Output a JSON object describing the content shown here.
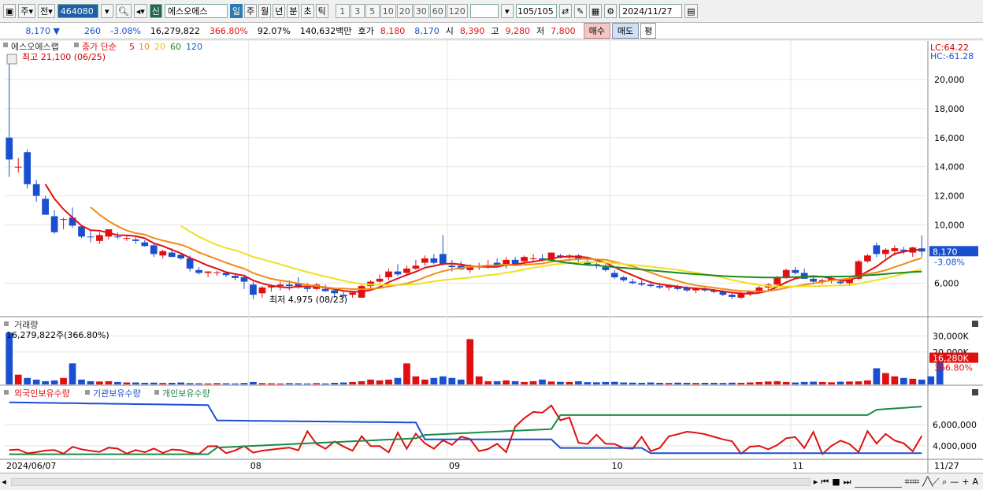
{
  "toolbar": {
    "market_label": "주",
    "type_label": "전",
    "code": "464080",
    "new_label": "신",
    "stock_name": "에스오에스",
    "periods": [
      "일",
      "주",
      "월",
      "년",
      "분",
      "초",
      "틱"
    ],
    "active_period": "일",
    "intervals": [
      "1",
      "3",
      "5",
      "10",
      "20",
      "30",
      "60",
      "120"
    ],
    "count": "105/105",
    "date": "2024/11/27"
  },
  "quote": {
    "price": "8,170",
    "change": "260",
    "change_pct": "-3.08%",
    "volume": "16,279,822",
    "volume_ratio": "366.80%",
    "turnover": "92.07%",
    "amount": "140,632백만",
    "ask_label": "호가",
    "ask": "8,180",
    "bid": "8,170",
    "open_label": "시",
    "open": "8,390",
    "high_label": "고",
    "high": "9,280",
    "low_label": "저",
    "low": "7,800",
    "buy_label": "매수",
    "sell_label": "매도",
    "eval_label": "평"
  },
  "chart_data": {
    "type": "candlestick",
    "price_panel": {
      "title": "에스오에스랩",
      "ma_label": "종가 단순",
      "ma_periods": [
        "5",
        "10",
        "20",
        "60",
        "120"
      ],
      "ma_colors": [
        "#e01010",
        "#f08c18",
        "#f0e020",
        "#1a8a2a",
        "#1060c0"
      ],
      "max_label": "최고 21,100 (06/25)",
      "min_label": "최저 4,975 (08/23)",
      "lc": "LC:64.22",
      "hc": "HC:-61.28",
      "y_ticks": [
        "20,000",
        "18,000",
        "16,000",
        "14,000",
        "12,000",
        "10,000",
        "6,000"
      ],
      "y_tick_values": [
        20000,
        18000,
        16000,
        14000,
        12000,
        10000,
        6000
      ],
      "ylim": [
        3800,
        22000
      ],
      "last_price": "8,170",
      "last_change": "-3.08%",
      "candles": [
        [
          16000,
          21100,
          13300,
          14500
        ],
        [
          14000,
          14600,
          13600,
          14000
        ],
        [
          15000,
          15200,
          12500,
          12800
        ],
        [
          12800,
          13100,
          11600,
          12000
        ],
        [
          11800,
          12000,
          10800,
          10700
        ],
        [
          10600,
          11000,
          9400,
          9500
        ],
        [
          10400,
          10500,
          9700,
          10400
        ],
        [
          10500,
          11200,
          9800,
          9950
        ],
        [
          9900,
          10000,
          9100,
          9200
        ],
        [
          9200,
          9600,
          8800,
          9150
        ],
        [
          8900,
          9500,
          8700,
          9300
        ],
        [
          9200,
          9700,
          9000,
          9700
        ],
        [
          9200,
          9500,
          9050,
          9150
        ],
        [
          9100,
          9300,
          8900,
          9100
        ],
        [
          9000,
          9200,
          8700,
          8900
        ],
        [
          8800,
          8950,
          8500,
          8550
        ],
        [
          8600,
          8700,
          7800,
          8000
        ],
        [
          7900,
          8300,
          7700,
          8200
        ],
        [
          8100,
          8400,
          7900,
          7800
        ],
        [
          7950,
          8100,
          7600,
          7700
        ],
        [
          7700,
          7900,
          6800,
          7000
        ],
        [
          6900,
          7100,
          6600,
          6700
        ],
        [
          6700,
          6800,
          6400,
          6800
        ],
        [
          6700,
          6850,
          6500,
          6750
        ],
        [
          6700,
          6800,
          6400,
          6550
        ],
        [
          6500,
          6600,
          6200,
          6350
        ],
        [
          6400,
          6600,
          5600,
          6100
        ],
        [
          5900,
          6100,
          4900,
          5200
        ],
        [
          5300,
          5800,
          5000,
          5700
        ],
        [
          5700,
          5900,
          5400,
          5800
        ],
        [
          5800,
          6100,
          5500,
          5900
        ],
        [
          5900,
          6200,
          5500,
          5800
        ],
        [
          6000,
          6400,
          5600,
          5700
        ],
        [
          5700,
          6000,
          5400,
          5600
        ],
        [
          5600,
          6000,
          5500,
          5900
        ],
        [
          5600,
          5900,
          5400,
          5450
        ],
        [
          5500,
          5600,
          5000,
          5300
        ],
        [
          5200,
          5500,
          4975,
          5100
        ],
        [
          5200,
          5400,
          5000,
          5350
        ],
        [
          5000,
          5900,
          4980,
          5800
        ],
        [
          5800,
          6200,
          5600,
          6100
        ],
        [
          6100,
          6600,
          6000,
          6300
        ],
        [
          6400,
          7000,
          6200,
          6800
        ],
        [
          6800,
          7300,
          6500,
          6600
        ],
        [
          6700,
          7200,
          6500,
          7000
        ],
        [
          7000,
          7600,
          6900,
          7200
        ],
        [
          7400,
          7900,
          7200,
          7700
        ],
        [
          7700,
          8000,
          7300,
          7400
        ],
        [
          8000,
          9300,
          7200,
          7300
        ],
        [
          7200,
          7600,
          6800,
          7100
        ],
        [
          7200,
          7500,
          6900,
          6950
        ],
        [
          6900,
          7300,
          6700,
          7100
        ],
        [
          7100,
          7400,
          6900,
          7200
        ],
        [
          7200,
          7600,
          7000,
          7250
        ],
        [
          7400,
          7700,
          7100,
          7100
        ],
        [
          7200,
          7800,
          7000,
          7600
        ],
        [
          7600,
          7800,
          7200,
          7200
        ],
        [
          7500,
          7900,
          7300,
          7800
        ],
        [
          7700,
          8000,
          7500,
          7700
        ],
        [
          7700,
          8000,
          7500,
          7600
        ],
        [
          7600,
          8100,
          7700,
          8100
        ],
        [
          7900,
          8000,
          7700,
          7800
        ],
        [
          7800,
          8000,
          7500,
          7900
        ],
        [
          7900,
          8000,
          7300,
          7700
        ],
        [
          7500,
          7700,
          7200,
          7300
        ],
        [
          7300,
          7500,
          7000,
          7200
        ],
        [
          7100,
          7300,
          6800,
          6900
        ],
        [
          6700,
          6900,
          6300,
          6400
        ],
        [
          6400,
          6500,
          6100,
          6200
        ],
        [
          6100,
          6300,
          5900,
          6000
        ],
        [
          6000,
          6200,
          5800,
          5900
        ],
        [
          5900,
          6100,
          5700,
          5800
        ],
        [
          5800,
          6000,
          5600,
          5700
        ],
        [
          5700,
          5900,
          5500,
          5800
        ],
        [
          5800,
          5900,
          5500,
          5600
        ],
        [
          5700,
          5800,
          5400,
          5500
        ],
        [
          5500,
          5700,
          5300,
          5600
        ],
        [
          5600,
          5700,
          5400,
          5500
        ],
        [
          5500,
          5600,
          5300,
          5400
        ],
        [
          5400,
          5500,
          5100,
          5200
        ],
        [
          5200,
          5300,
          4900,
          5050
        ],
        [
          5000,
          5400,
          4900,
          5300
        ],
        [
          5300,
          5500,
          5100,
          5400
        ],
        [
          5400,
          5800,
          5300,
          5700
        ],
        [
          5700,
          6000,
          5500,
          5900
        ],
        [
          5900,
          6500,
          5800,
          6400
        ],
        [
          6400,
          7000,
          6300,
          6900
        ],
        [
          6900,
          7100,
          6600,
          6700
        ],
        [
          6700,
          7000,
          6300,
          6300
        ],
        [
          6300,
          6400,
          6000,
          6100
        ],
        [
          6100,
          6300,
          5900,
          6200
        ],
        [
          6200,
          6500,
          6000,
          6300
        ],
        [
          6100,
          6300,
          5900,
          6000
        ],
        [
          6000,
          6400,
          5800,
          6300
        ],
        [
          6300,
          7600,
          6200,
          7500
        ],
        [
          7500,
          8000,
          7400,
          7900
        ],
        [
          8600,
          8800,
          7800,
          8000
        ],
        [
          8000,
          8400,
          7700,
          8300
        ],
        [
          8200,
          8600,
          7900,
          8400
        ],
        [
          8300,
          8500,
          8000,
          8200
        ],
        [
          8100,
          8500,
          7800,
          8450
        ],
        [
          8390,
          9280,
          7800,
          8170
        ]
      ]
    },
    "volume_panel": {
      "title": "거래량",
      "value_label": "16,279,822주(366.80%)",
      "y_ticks": [
        "30,000K",
        "20,000K"
      ],
      "y_tick_values": [
        30000,
        20000
      ],
      "ylim": [
        0,
        37000
      ],
      "last_label": "16,280K",
      "last_pct": "366.80%",
      "values": [
        32000,
        6000,
        4000,
        3000,
        2000,
        2500,
        4000,
        13000,
        3000,
        2000,
        1800,
        2000,
        1500,
        1200,
        1200,
        1000,
        1100,
        900,
        1000,
        1200,
        800,
        700,
        600,
        800,
        700,
        600,
        900,
        1500,
        800,
        700,
        600,
        800,
        700,
        600,
        800,
        600,
        1000,
        1200,
        1500,
        2000,
        3000,
        2500,
        3000,
        4000,
        13000,
        5000,
        3000,
        4000,
        5000,
        4000,
        3000,
        28000,
        5000,
        2000,
        2000,
        2500,
        2000,
        1500,
        2000,
        3000,
        1800,
        1600,
        1500,
        2000,
        1400,
        1300,
        1500,
        1600,
        1200,
        1100,
        1000,
        1200,
        1000,
        900,
        1100,
        1000,
        900,
        1000,
        1000,
        900,
        1100,
        1000,
        1200,
        1500,
        1800,
        2000,
        1500,
        1200,
        1500,
        1700,
        1500,
        1300,
        1700,
        1800,
        1900,
        2500,
        10000,
        7000,
        5000,
        4000,
        3500,
        3000,
        5000,
        16280
      ]
    },
    "holding_panel": {
      "series_names": [
        "외국인보유수량",
        "기관보유수량",
        "개인보유수량"
      ],
      "colors": [
        "#e01010",
        "#1a4fd0",
        "#1a8a4a"
      ],
      "y_ticks": [
        "6,000,000",
        "4,000,000"
      ],
      "y_tick_values": [
        6000000,
        4000000
      ],
      "ylim": [
        2800000,
        8600000
      ]
    },
    "x_labels": [
      "2024/06/07",
      "08",
      "09",
      "10",
      "11",
      "11/27"
    ],
    "x_label_index": [
      0,
      27,
      49,
      67,
      87,
      104
    ]
  }
}
